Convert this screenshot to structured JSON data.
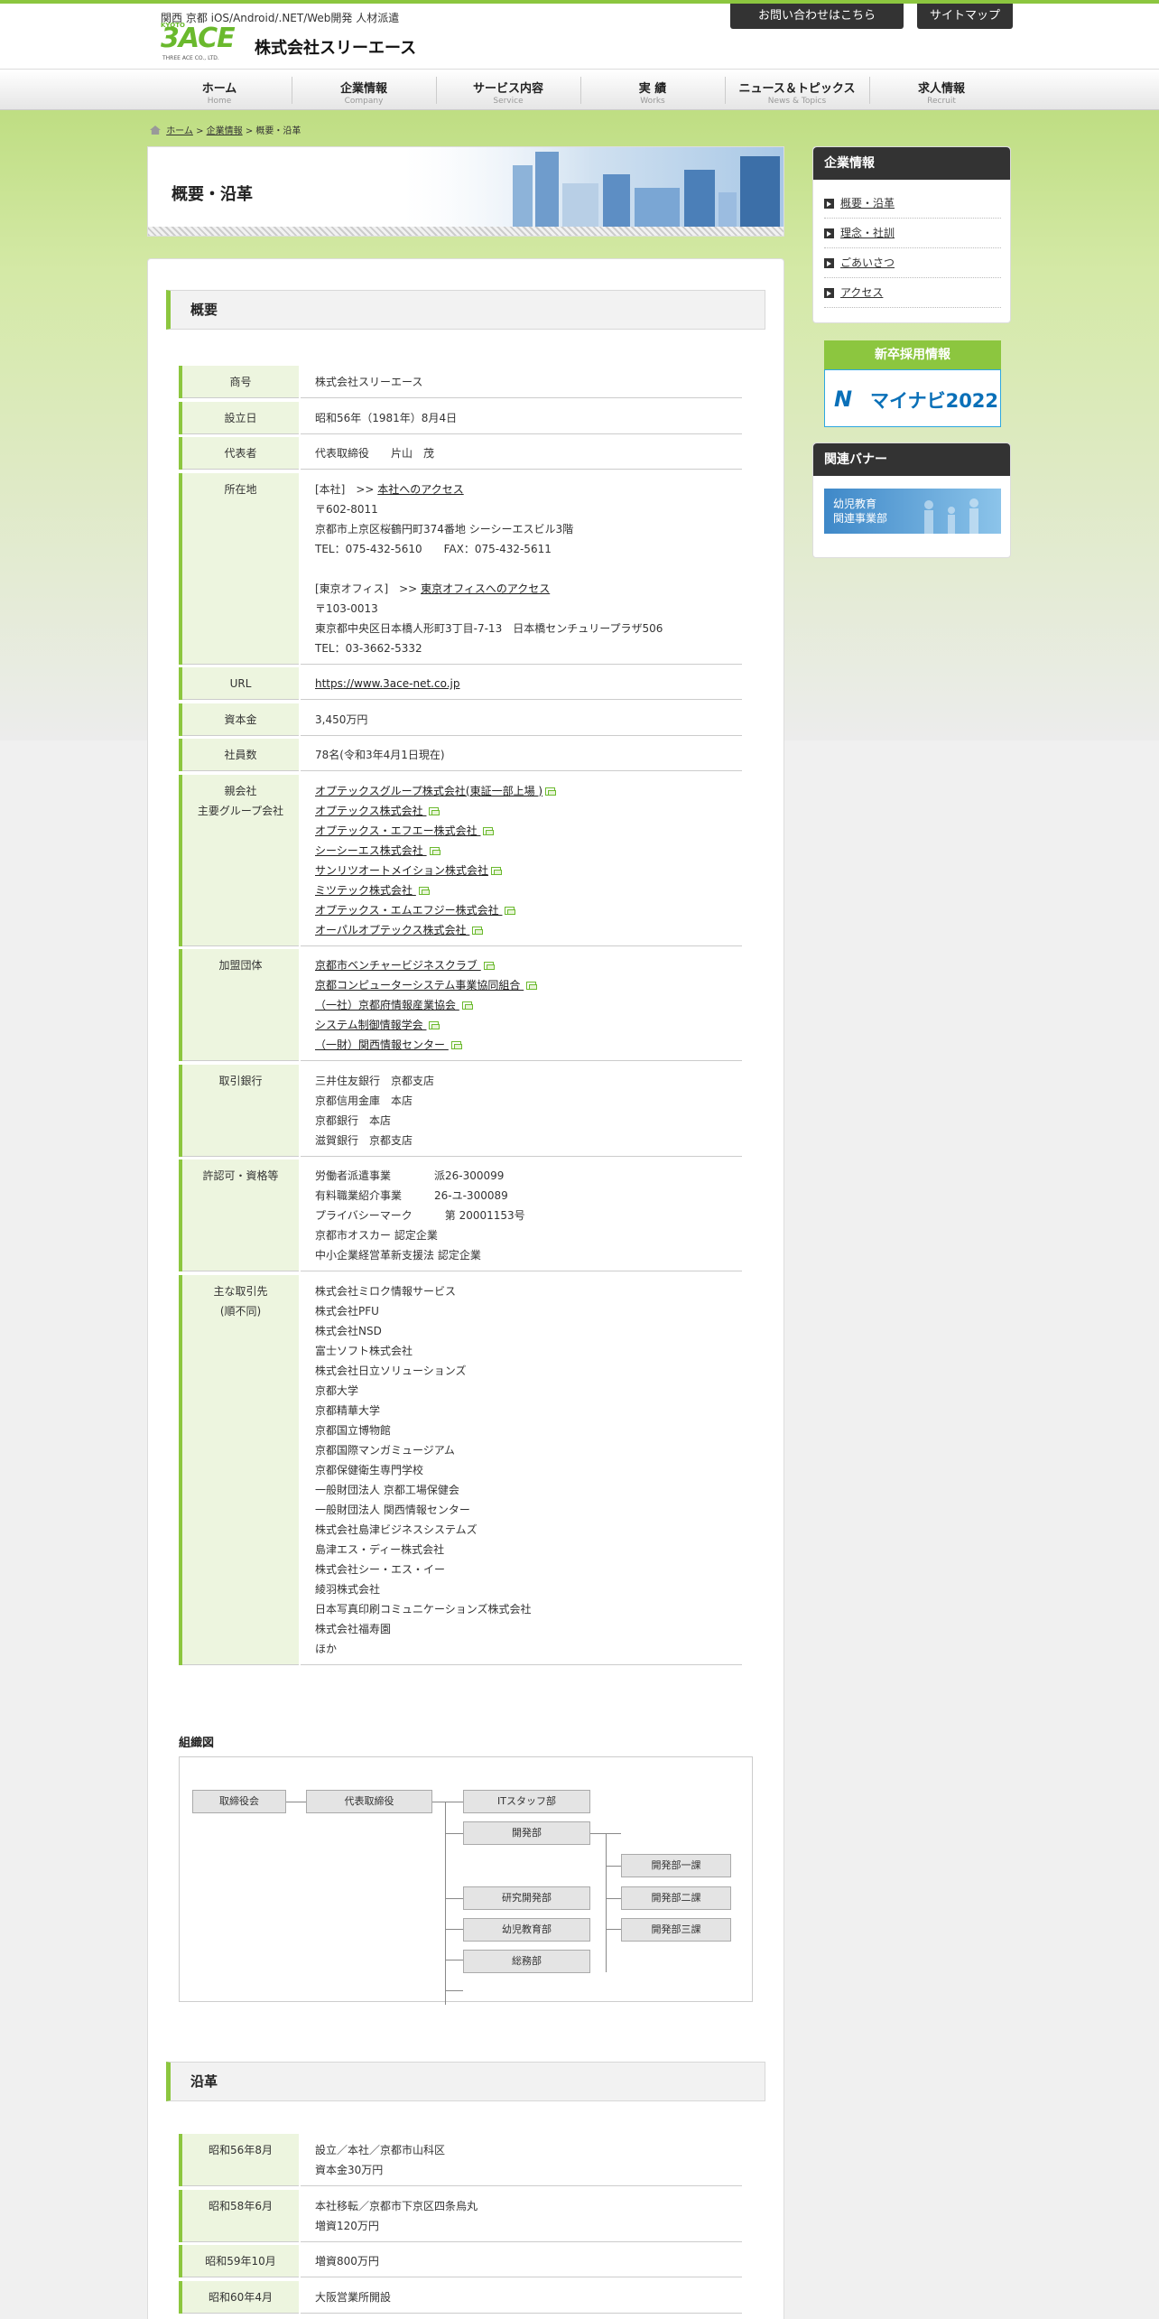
{
  "header": {
    "tagline": "関西 京都 iOS/Android/.NET/Web開発 人材派遣",
    "logo_kyoto": "KYOTO",
    "logo_mark": "3ACE",
    "logo_sub": "THREE ACE CO., LTD.",
    "company_name": "株式会社スリーエース",
    "contact_button": "お問い合わせはこちら",
    "sitemap_button": "サイトマップ"
  },
  "nav": [
    {
      "jp": "ホーム",
      "en": "Home"
    },
    {
      "jp": "企業情報",
      "en": "Company"
    },
    {
      "jp": "サービス内容",
      "en": "Service"
    },
    {
      "jp": "実 績",
      "en": "Works"
    },
    {
      "jp": "ニュース＆トピックス",
      "en": "News & Topics"
    },
    {
      "jp": "求人情報",
      "en": "Recruit"
    }
  ],
  "breadcrumb": {
    "home": "ホーム",
    "company": "企業情報",
    "current": "概要・沿革",
    "sep": ">"
  },
  "page_title": "概要・沿革",
  "overview": {
    "heading": "概要",
    "rows": [
      {
        "label": "商号",
        "lines": [
          "株式会社スリーエース"
        ]
      },
      {
        "label": "設立日",
        "lines": [
          "昭和56年（1981年）8月4日"
        ]
      },
      {
        "label": "代表者",
        "lines": [
          "代表取締役　　片山　茂"
        ]
      },
      {
        "label": "所在地",
        "hq_prefix": "[本社]　>> ",
        "hq_link": "本社へのアクセス",
        "hq_lines": [
          "〒602-8011",
          "京都市上京区桜鶴円町374番地 シーシーエスビル3階",
          "TEL：075-432-5610　　FAX：075-432-5611"
        ],
        "tokyo_prefix": "[東京オフィス]　>> ",
        "tokyo_link": "東京オフィスへのアクセス",
        "tokyo_lines": [
          "〒103-0013",
          "東京都中央区日本橋人形町3丁目-7-13　日本橋センチュリープラザ506",
          "TEL：03-3662-5332"
        ]
      },
      {
        "label": "URL",
        "link": "https://www.3ace-net.co.jp"
      },
      {
        "label": "資本金",
        "lines": [
          "3,450万円"
        ]
      },
      {
        "label": "社員数",
        "lines": [
          "78名(令和3年4月1日現在)"
        ]
      },
      {
        "label": "親会社\n主要グループ会社",
        "links": [
          "オプテックスグループ株式会社(東証一部上場 )",
          "オプテックス株式会社 ",
          "オプテックス・エフエー株式会社 ",
          "シーシーエス株式会社 ",
          "サンリツオートメイション株式会社",
          "ミツテック株式会社 ",
          "オプテックス・エムエフジー株式会社 ",
          "オーパルオプテックス株式会社 "
        ]
      },
      {
        "label": "加盟団体",
        "links": [
          "京都市ベンチャービジネスクラブ ",
          "京都コンピューターシステム事業協同組合 ",
          "（一社）京都府情報産業協会 ",
          "システム制御情報学会 ",
          "（一財）関西情報センター "
        ]
      },
      {
        "label": "取引銀行",
        "lines": [
          "三井住友銀行　京都支店",
          "京都信用金庫　本店",
          "京都銀行　本店",
          "滋賀銀行　京都支店"
        ]
      },
      {
        "label": "許認可・資格等",
        "lines": [
          "労働者派遣事業　　　　派26-300099",
          "有料職業紹介事業　　　26-ユ-300089",
          "プライバシーマーク　　　第 20001153号",
          "京都市オスカー 認定企業",
          "中小企業経営革新支援法 認定企業"
        ]
      },
      {
        "label": "主な取引先\n(順不同)",
        "lines": [
          "株式会社ミロク情報サービス",
          "株式会社PFU",
          "株式会社NSD",
          "富士ソフト株式会社",
          "株式会社日立ソリューションズ",
          "京都大学",
          "京都精華大学",
          "京都国立博物館",
          "京都国際マンガミュージアム",
          "京都保健衛生専門学校",
          "一般財団法人 京都工場保健会",
          "一般財団法人 関西情報センター",
          "株式会社島津ビジネスシステムズ",
          "島津エス・ディー株式会社",
          "株式会社シー・エス・イー",
          "綾羽株式会社",
          "日本写真印刷コミュニケーションズ株式会社",
          "株式会社福寿園",
          "ほか"
        ]
      }
    ]
  },
  "org": {
    "title": "組織図",
    "board": "取締役会",
    "ceo": "代表取締役",
    "it_staff": "ITスタッフ部",
    "dev": "開発部",
    "dev1": "開発部一課",
    "dev2": "開発部二課",
    "dev3": "開発部三課",
    "research": "研究開発部",
    "kids": "幼児教育部",
    "general": "総務部"
  },
  "history": {
    "heading": "沿革",
    "rows": [
      {
        "label": "昭和56年8月",
        "lines": [
          "設立／本社／京都市山科区",
          "資本金30万円"
        ]
      },
      {
        "label": "昭和58年6月",
        "lines": [
          "本社移転／京都市下京区四条烏丸",
          "増資120万円"
        ]
      },
      {
        "label": "昭和59年10月",
        "lines": [
          "増資800万円"
        ]
      },
      {
        "label": "昭和60年4月",
        "lines": [
          "大阪営業所開設"
        ]
      }
    ]
  },
  "sidebar": {
    "company_heading": "企業情報",
    "items": [
      "概要・沿革",
      "理念・社訓",
      "ごあいさつ",
      "アクセス"
    ],
    "recruit_label": "新卒採用情報",
    "mynavi_text": "マイナビ2022",
    "banner_heading": "関連バナー",
    "kids_banner": [
      "幼児教育",
      "関連事業部"
    ]
  },
  "colors": {
    "accent": "#8cc63f",
    "dark": "#333333",
    "label_bg": "#edf5df"
  }
}
